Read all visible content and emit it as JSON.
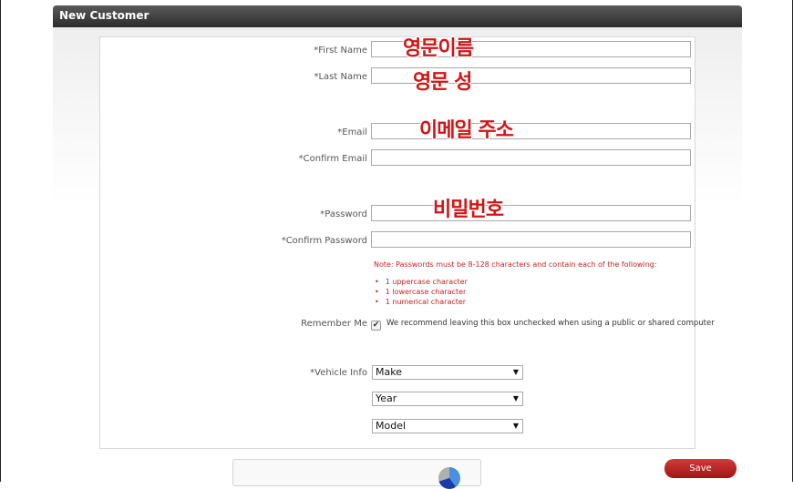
{
  "panel": {
    "title": "New Customer"
  },
  "fields": {
    "first_name": {
      "label": "*First Name",
      "value": "",
      "overlay": "영문이름"
    },
    "last_name": {
      "label": "*Last Name",
      "value": "",
      "overlay": "영문 성"
    },
    "email": {
      "label": "*Email",
      "value": "",
      "overlay": "이메일 주소"
    },
    "confirm_email": {
      "label": "*Confirm Email",
      "value": ""
    },
    "password": {
      "label": "*Password",
      "value": "",
      "overlay": "비밀번호"
    },
    "confirm_password": {
      "label": "*Confirm Password",
      "value": ""
    }
  },
  "password_note": {
    "text": "Note: Passwords must be 8-128 characters and contain each of the following:",
    "requirements": [
      "1 uppercase character",
      "1 lowercase character",
      "1 numerical character"
    ]
  },
  "remember_me": {
    "label": "Remember Me",
    "checked": true,
    "note": "We recommend leaving this box unchecked when using a public or shared computer"
  },
  "vehicle_info": {
    "label": "*Vehicle Info",
    "make": "Make",
    "year": "Year",
    "model": "Model"
  },
  "actions": {
    "save_label": "Save"
  },
  "colors": {
    "header": "#3a3a3a",
    "accent": "#c42323",
    "save": "#b71c1c"
  }
}
